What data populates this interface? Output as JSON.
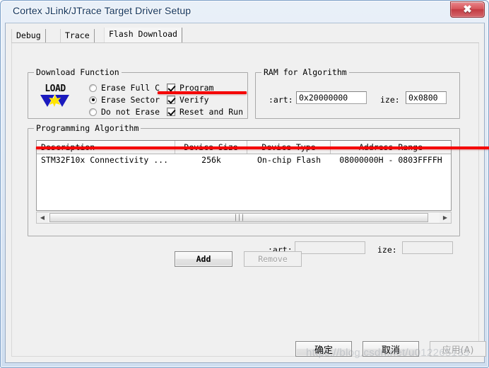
{
  "window": {
    "title": "Cortex JLink/JTrace Target Driver Setup",
    "close_label": "✖",
    "close_icon": "close-icon"
  },
  "tabs": [
    {
      "label": "Debug",
      "active": false
    },
    {
      "label": "Trace",
      "active": false
    },
    {
      "label": "Flash Download",
      "active": true
    }
  ],
  "download_function": {
    "caption": "Download Function",
    "icon_label": "LOAD",
    "radios": [
      {
        "label": "Erase Full C",
        "checked": false
      },
      {
        "label": "Erase Sector",
        "checked": true
      },
      {
        "label": "Do not Erase",
        "checked": false
      }
    ],
    "checkboxes": [
      {
        "label": "Program",
        "checked": true
      },
      {
        "label": "Verify",
        "checked": true
      },
      {
        "label": "Reset and Run",
        "checked": true
      }
    ]
  },
  "ram_for_algorithm": {
    "caption": "RAM for Algorithm",
    "start_label": ":art:",
    "start_value": "0x20000000",
    "size_label": "ize:",
    "size_value": "0x0800"
  },
  "programming_algorithm": {
    "caption": "Programming Algorithm",
    "columns": [
      "Description",
      "Device Size",
      "Device Type",
      "Address Range"
    ],
    "rows": [
      {
        "description": "STM32F10x Connectivity ...",
        "device_size": "256k",
        "device_type": "On-chip Flash",
        "address_range": "08000000H - 0803FFFFH"
      }
    ],
    "scrollbar": {
      "left_arrow": "◀",
      "right_arrow": "▶",
      "grip": "|||"
    },
    "start_label": ":art:",
    "start_value": "",
    "size_label": "ize:",
    "size_value": ""
  },
  "list_buttons": {
    "add": "Add",
    "remove": "Remove",
    "remove_disabled": true
  },
  "dialog_buttons": {
    "ok": "确定",
    "cancel": "取消",
    "apply": "应用(A)",
    "apply_disabled": true
  },
  "annotations": {
    "color": "#f50000",
    "count": 2
  },
  "watermark": {
    "text": "https://blog.csdn.net/u012265133"
  }
}
